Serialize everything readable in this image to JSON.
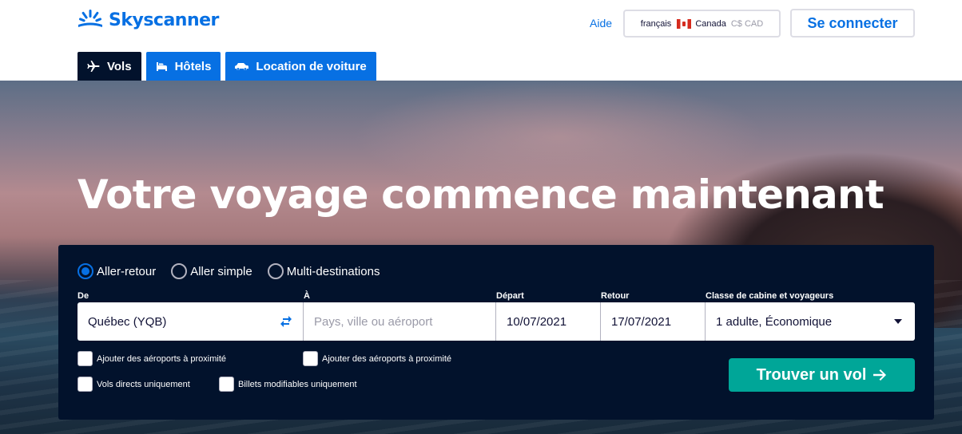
{
  "brand": {
    "name": "Skyscanner",
    "color": "#0770e3"
  },
  "header": {
    "help": "Aide",
    "locale": {
      "language": "français",
      "country": "Canada",
      "currency": "C$ CAD"
    },
    "login": "Se connecter"
  },
  "tabs": [
    {
      "label": "Vols",
      "icon": "plane-icon",
      "active": true
    },
    {
      "label": "Hôtels",
      "icon": "bed-icon",
      "active": false
    },
    {
      "label": "Location de voiture",
      "icon": "car-icon",
      "active": false
    }
  ],
  "hero": {
    "title": "Votre voyage commence maintenant"
  },
  "search": {
    "trip_types": [
      {
        "label": "Aller-retour",
        "selected": true
      },
      {
        "label": "Aller simple",
        "selected": false
      },
      {
        "label": "Multi-destinations",
        "selected": false
      }
    ],
    "from": {
      "label": "De",
      "value": "Québec (YQB)"
    },
    "to": {
      "label": "À",
      "value": "",
      "placeholder": "Pays, ville ou aéroport"
    },
    "depart": {
      "label": "Départ",
      "value": "10/07/2021"
    },
    "return": {
      "label": "Retour",
      "value": "17/07/2021"
    },
    "cabin": {
      "label": "Classe de cabine et voyageurs",
      "value": "1 adulte, Économique"
    },
    "options": {
      "nearby_from": "Ajouter des aéroports à proximité",
      "nearby_to": "Ajouter des aéroports à proximité",
      "direct_only": "Vols directs uniquement",
      "flexible_only": "Billets modifiables uniquement"
    },
    "submit": "Trouver un vol"
  },
  "colors": {
    "navy": "#02122c",
    "accent_blue": "#0770e3",
    "teal": "#00a698"
  }
}
